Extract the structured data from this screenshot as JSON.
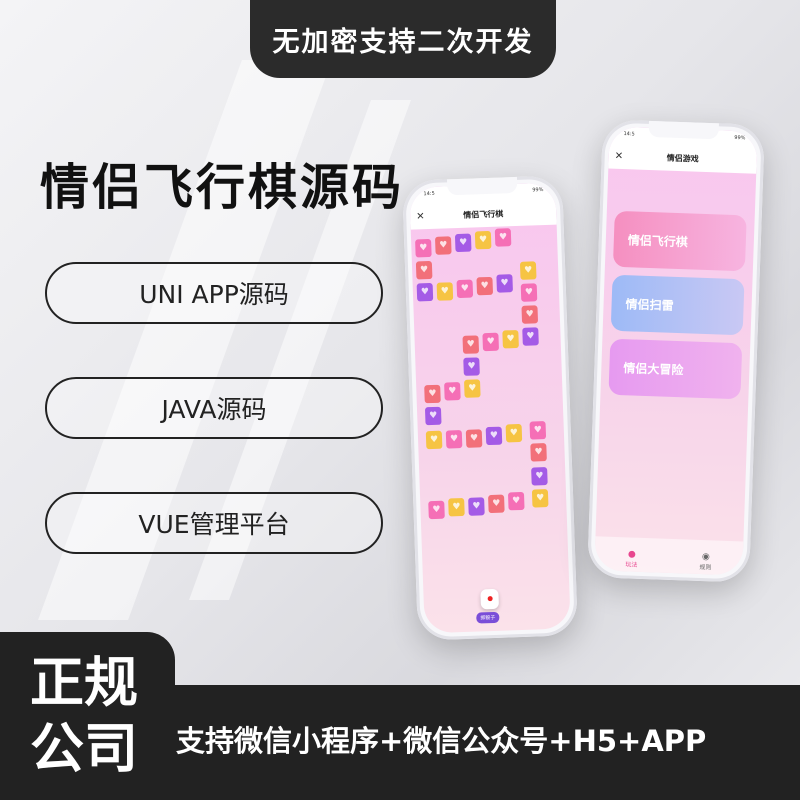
{
  "top_banner": "无加密支持二次开发",
  "title": "情侣飞行棋源码",
  "features": [
    "UNI APP源码",
    "JAVA源码",
    "VUE管理平台"
  ],
  "bottom": {
    "badge": "正规公司",
    "support": "支持微信小程序+微信公众号+H5+APP"
  },
  "phone_left": {
    "time": "14:5",
    "battery": "99%",
    "title": "情侣飞行棋",
    "dice_label": "掷骰子"
  },
  "phone_right": {
    "time": "14:5",
    "battery": "99%",
    "title": "情侣游戏",
    "games": [
      "情侣飞行棋",
      "情侣扫雷",
      "情侣大冒险"
    ],
    "tabs": [
      "玩法",
      "规则"
    ]
  },
  "colors": {
    "dark": "#222222",
    "tile_pink": "#f56fb6",
    "tile_red": "#f2707a",
    "tile_purple": "#a45be6",
    "tile_yellow": "#f6c443"
  }
}
